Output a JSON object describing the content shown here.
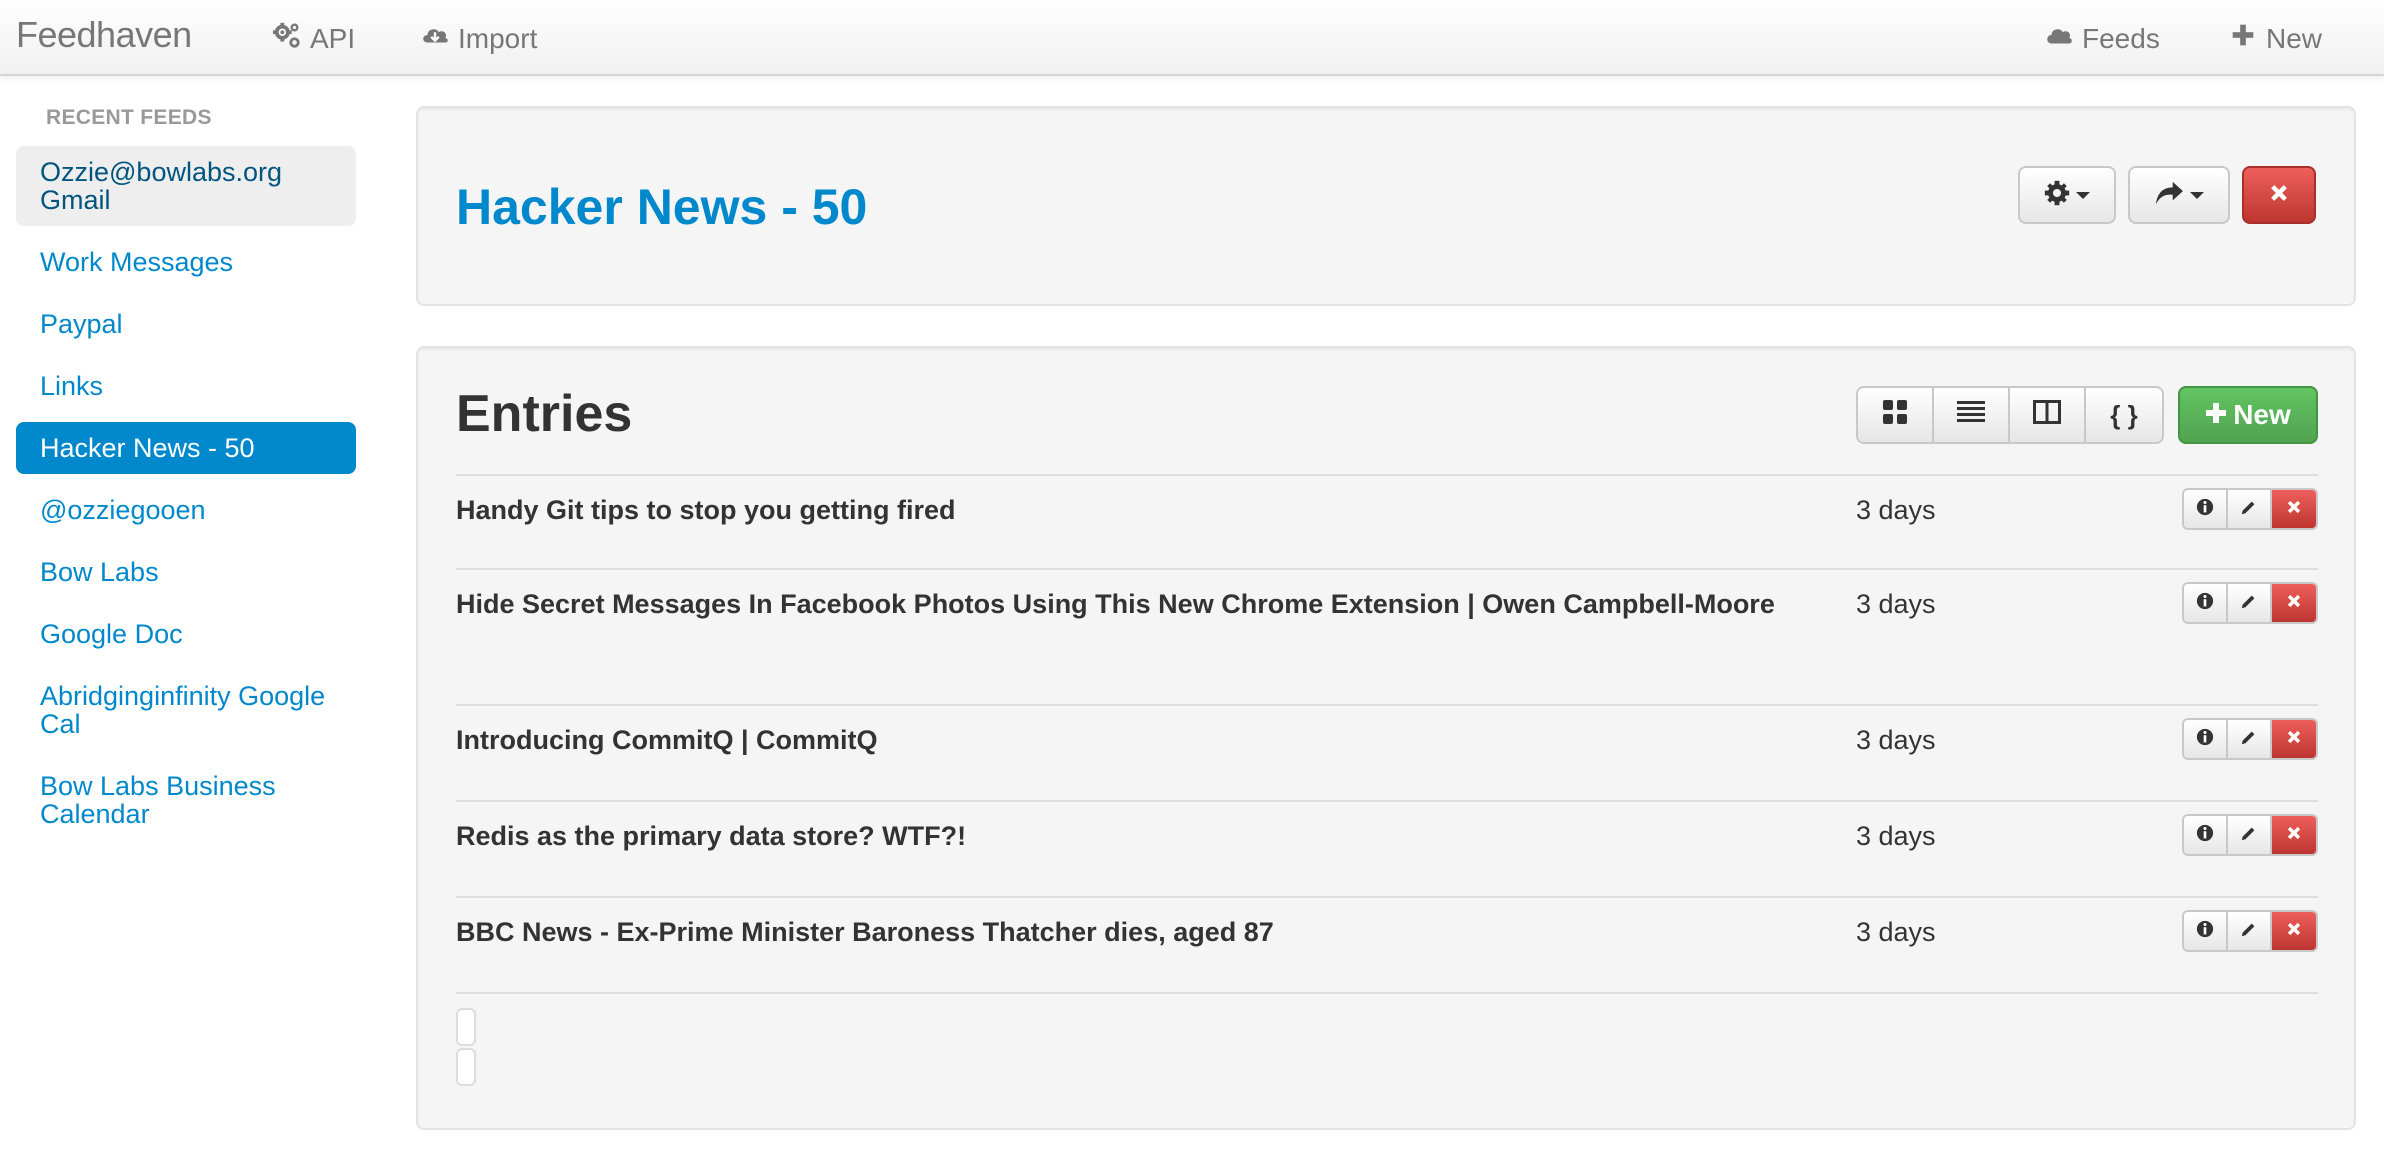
{
  "navbar": {
    "brand": "Feedhaven",
    "links_left": [
      {
        "label": "API",
        "icon": "gears-icon"
      },
      {
        "label": "Import",
        "icon": "cloud-download-icon"
      }
    ],
    "links_right": [
      {
        "label": "Feeds",
        "icon": "cloud-icon"
      },
      {
        "label": "New",
        "icon": "plus-icon"
      }
    ]
  },
  "sidebar": {
    "header": "RECENT FEEDS",
    "items": [
      {
        "label": "Ozzie@bowlabs.org Gmail",
        "state": "hover"
      },
      {
        "label": "Work Messages"
      },
      {
        "label": "Paypal"
      },
      {
        "label": "Links"
      },
      {
        "label": "Hacker News - 50",
        "state": "active"
      },
      {
        "label": "@ozziegooen"
      },
      {
        "label": "Bow Labs"
      },
      {
        "label": "Google Doc"
      },
      {
        "label": "Abridginginfinity Google Cal"
      },
      {
        "label": "Bow Labs Business Calendar"
      }
    ]
  },
  "feed": {
    "title": "Hacker News - 50"
  },
  "entries": {
    "title": "Entries",
    "new_label": "New",
    "rows": [
      {
        "title": "Handy Git tips to stop you getting fired",
        "age": "3 days"
      },
      {
        "title": "Hide Secret Messages In Facebook Photos Using This New Chrome Extension | Owen Campbell-Moore",
        "age": "3 days"
      },
      {
        "title": "Introducing CommitQ | CommitQ",
        "age": "3 days"
      },
      {
        "title": "Redis as the primary data store? WTF?!",
        "age": "3 days"
      },
      {
        "title": "BBC News - Ex-Prime Minister Baroness Thatcher dies, aged 87",
        "age": "3 days"
      }
    ]
  },
  "colors": {
    "link": "#0088cc",
    "danger": "#da4f49",
    "success": "#5bb75b",
    "well": "#f5f5f5"
  }
}
